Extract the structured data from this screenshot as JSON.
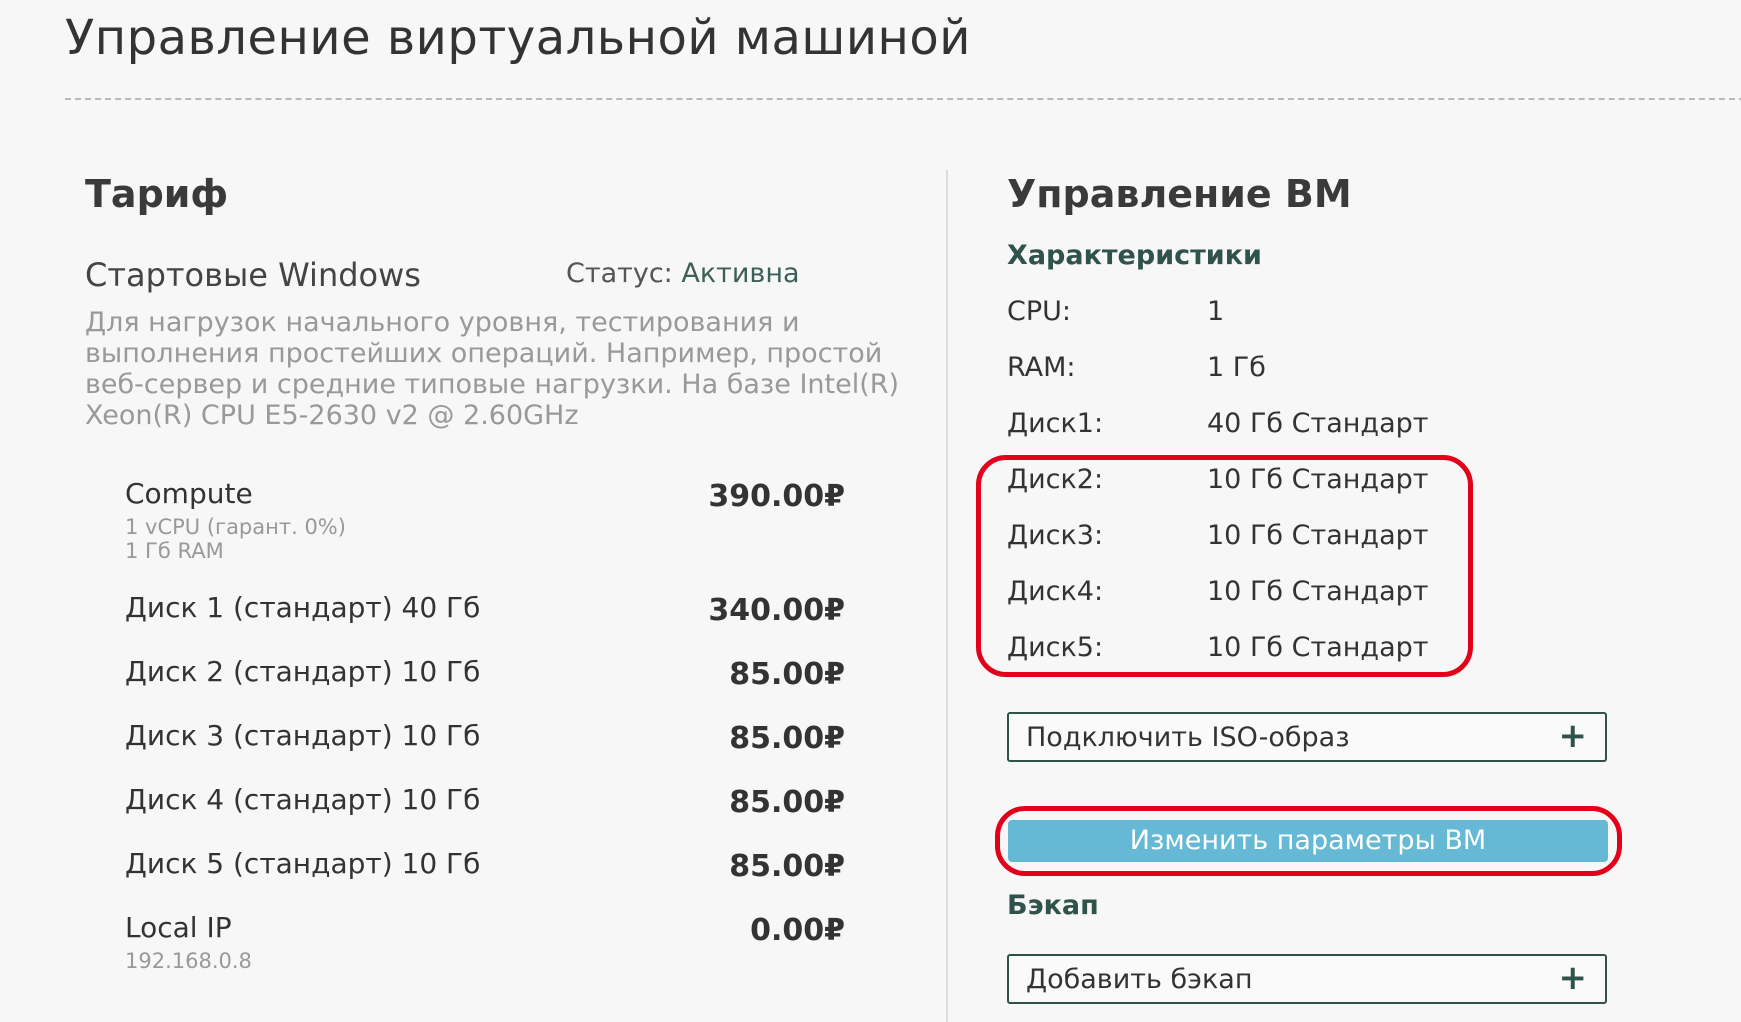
{
  "page": {
    "title": "Управление виртуальной машиной"
  },
  "tariff": {
    "heading": "Тариф",
    "plan_name": "Стартовые Windows",
    "status_label": "Статус:",
    "status_value": "Активна",
    "description": "Для нагрузок начального уровня, тестирования и выполнения простейших операций. Например, простой веб-сервер и средние типовые нагрузки. На базе Intel(R) Xeon(R) CPU E5-2630 v2 @ 2.60GHz",
    "items": [
      {
        "label": "Compute",
        "price": "390.00₽",
        "sub": [
          "1 vCPU (гарант. 0%)",
          "1 Гб RAM"
        ]
      },
      {
        "label": "Диск 1 (стандарт) 40 Гб",
        "price": "340.00₽",
        "sub": []
      },
      {
        "label": "Диск 2 (стандарт) 10 Гб",
        "price": "85.00₽",
        "sub": []
      },
      {
        "label": "Диск 3 (стандарт) 10 Гб",
        "price": "85.00₽",
        "sub": []
      },
      {
        "label": "Диск 4 (стандарт) 10 Гб",
        "price": "85.00₽",
        "sub": []
      },
      {
        "label": "Диск 5 (стандарт) 10 Гб",
        "price": "85.00₽",
        "sub": []
      },
      {
        "label": "Local IP",
        "price": "0.00₽",
        "sub": [
          "192.168.0.8"
        ]
      }
    ]
  },
  "vm": {
    "heading": "Управление ВМ",
    "specs_heading": "Характеристики",
    "specs": [
      {
        "label": "CPU:",
        "value": "1"
      },
      {
        "label": "RAM:",
        "value": "1 Гб"
      },
      {
        "label": "Диск1:",
        "value": "40 Гб Стандарт"
      },
      {
        "label": "Диск2:",
        "value": "10 Гб Стандарт"
      },
      {
        "label": "Диск3:",
        "value": "10 Гб Стандарт"
      },
      {
        "label": "Диск4:",
        "value": "10 Гб Стандарт"
      },
      {
        "label": "Диск5:",
        "value": "10 Гб Стандарт"
      }
    ],
    "iso_button": "Подключить ISO-образ",
    "change_button": "Изменить параметры ВМ",
    "backup_heading": "Бэкап",
    "backup_button": "Добавить бэкап",
    "plus_glyph": "+"
  },
  "colors": {
    "highlight": "#e2001a",
    "primary_button": "#66b9d5",
    "accent": "#2f524a"
  }
}
